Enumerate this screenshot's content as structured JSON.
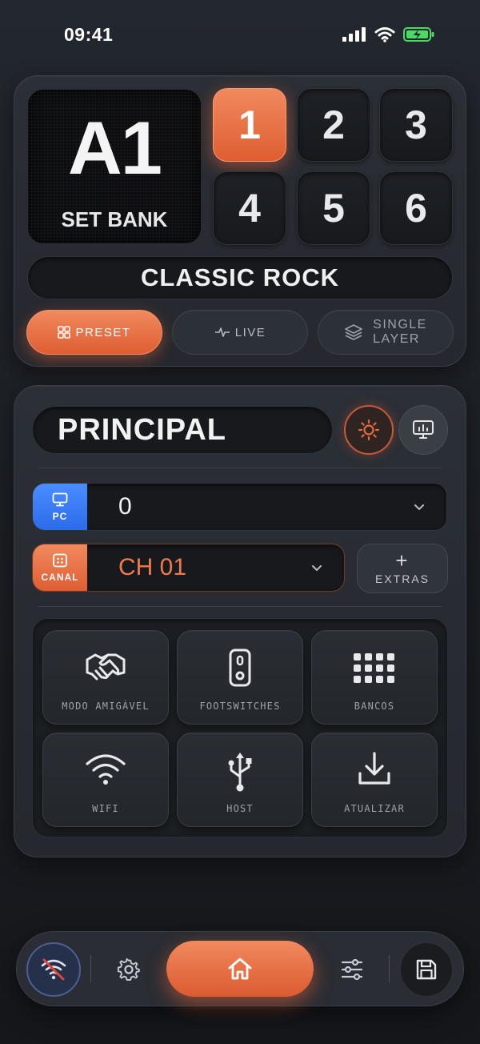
{
  "status_bar": {
    "time": "09:41"
  },
  "bank": {
    "code": "A1",
    "label": "SET BANK"
  },
  "presets": [
    {
      "label": "1",
      "active": true
    },
    {
      "label": "2",
      "active": false
    },
    {
      "label": "3",
      "active": false
    },
    {
      "label": "4",
      "active": false
    },
    {
      "label": "5",
      "active": false
    },
    {
      "label": "6",
      "active": false
    }
  ],
  "preset_name": "CLASSIC ROCK",
  "modes": {
    "preset": "PRESET",
    "live": "LIVE",
    "single_line1": "SINGLE",
    "single_line2": "LAYER"
  },
  "principal": {
    "title": "PRINCIPAL"
  },
  "pc": {
    "tag": "PC",
    "value": "0"
  },
  "canal": {
    "tag": "CANAL",
    "value": "CH 01"
  },
  "extras": {
    "plus": "+",
    "label": "EXTRAS"
  },
  "tiles": [
    {
      "label": "MODO AMIGÁVEL",
      "icon": "handshake-icon"
    },
    {
      "label": "FOOTSWITCHES",
      "icon": "footswitch-icon"
    },
    {
      "label": "BANCOS",
      "icon": "grid-dots-icon"
    },
    {
      "label": "WIFI",
      "icon": "wifi-icon"
    },
    {
      "label": "HOST",
      "icon": "usb-icon"
    },
    {
      "label": "ATUALIZAR",
      "icon": "download-icon"
    }
  ],
  "colors": {
    "accent": "#e9683d",
    "pc_blue": "#3a7bf5",
    "canal_text": "#f07a4c",
    "battery_green": "#4cd964"
  }
}
